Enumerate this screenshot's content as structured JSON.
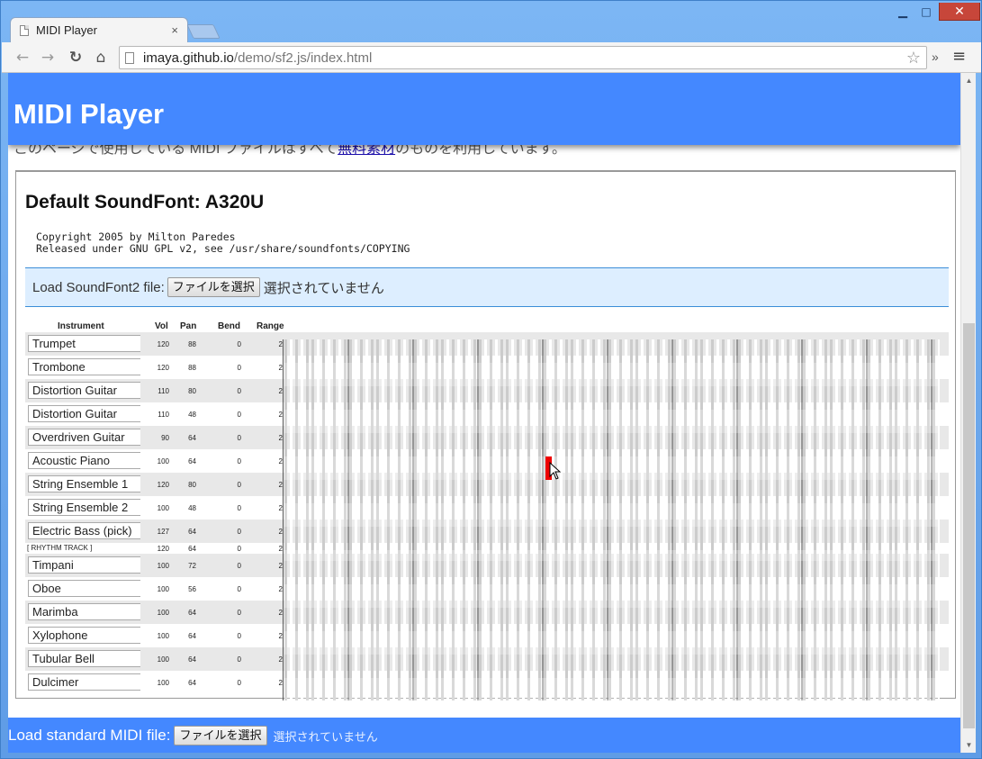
{
  "browser": {
    "tab_title": "MIDI Player",
    "tab_close": "×",
    "url_host": "imaya.github.io",
    "url_path": "/demo/sf2.js/index.html",
    "window_controls": {
      "minimize": "▁",
      "maximize": "□",
      "close": "✕"
    },
    "icons": {
      "back": "←",
      "forward": "→",
      "reload": "↻",
      "home": "⌂",
      "star": "☆",
      "extensions": "»",
      "menu": "≡"
    }
  },
  "header": {
    "title": "MIDI Player",
    "background": "#4488ff",
    "obscured_text_pre": "このページで使用している MIDI ファイルはすべて",
    "obscured_link": "無料素材",
    "obscured_text_post": "のものを利用しています。"
  },
  "soundfont": {
    "title": "Default SoundFont: A320U",
    "copyright": "Copyright 2005 by Milton Paredes\nReleased under GNU GPL v2, see /usr/share/soundfonts/COPYING",
    "load_label": "Load SoundFont2 file:",
    "file_button": "ファイルを選択",
    "file_status": "選択されていません"
  },
  "table": {
    "headers": {
      "instrument": "Instrument",
      "vol": "Vol",
      "pan": "Pan",
      "bend": "Bend",
      "range": "Range"
    },
    "rows": [
      {
        "name": "Trumpet",
        "vol": "120",
        "pan": "88",
        "bend": "0",
        "range": "2"
      },
      {
        "name": "Trombone",
        "vol": "120",
        "pan": "88",
        "bend": "0",
        "range": "2"
      },
      {
        "name": "Distortion Guitar",
        "vol": "110",
        "pan": "80",
        "bend": "0",
        "range": "2"
      },
      {
        "name": "Distortion Guitar",
        "vol": "110",
        "pan": "48",
        "bend": "0",
        "range": "2"
      },
      {
        "name": "Overdriven Guitar",
        "vol": "90",
        "pan": "64",
        "bend": "0",
        "range": "2"
      },
      {
        "name": "Acoustic Piano",
        "vol": "100",
        "pan": "64",
        "bend": "0",
        "range": "2"
      },
      {
        "name": "String Ensemble 1",
        "vol": "120",
        "pan": "80",
        "bend": "0",
        "range": "2"
      },
      {
        "name": "String Ensemble 2",
        "vol": "100",
        "pan": "48",
        "bend": "0",
        "range": "2"
      },
      {
        "name": "Electric Bass (pick)",
        "vol": "127",
        "pan": "64",
        "bend": "0",
        "range": "2"
      },
      {
        "name": "[ RHYTHM TRACK ]",
        "vol": "120",
        "pan": "64",
        "bend": "0",
        "range": "2",
        "rhythm": true
      },
      {
        "name": "Timpani",
        "vol": "100",
        "pan": "72",
        "bend": "0",
        "range": "2"
      },
      {
        "name": "Oboe",
        "vol": "100",
        "pan": "56",
        "bend": "0",
        "range": "2"
      },
      {
        "name": "Marimba",
        "vol": "100",
        "pan": "64",
        "bend": "0",
        "range": "2"
      },
      {
        "name": "Xylophone",
        "vol": "100",
        "pan": "64",
        "bend": "0",
        "range": "2"
      },
      {
        "name": "Tubular Bell",
        "vol": "100",
        "pan": "64",
        "bend": "0",
        "range": "2"
      },
      {
        "name": "Dulcimer",
        "vol": "100",
        "pan": "64",
        "bend": "0",
        "range": "2"
      }
    ]
  },
  "keyboard": {
    "key_color": "#cccccc",
    "active_color": "#ee0000"
  },
  "footer": {
    "label": "Load standard MIDI file:",
    "file_button": "ファイルを選択",
    "file_status": "選択されていません",
    "background": "#4488ff"
  }
}
